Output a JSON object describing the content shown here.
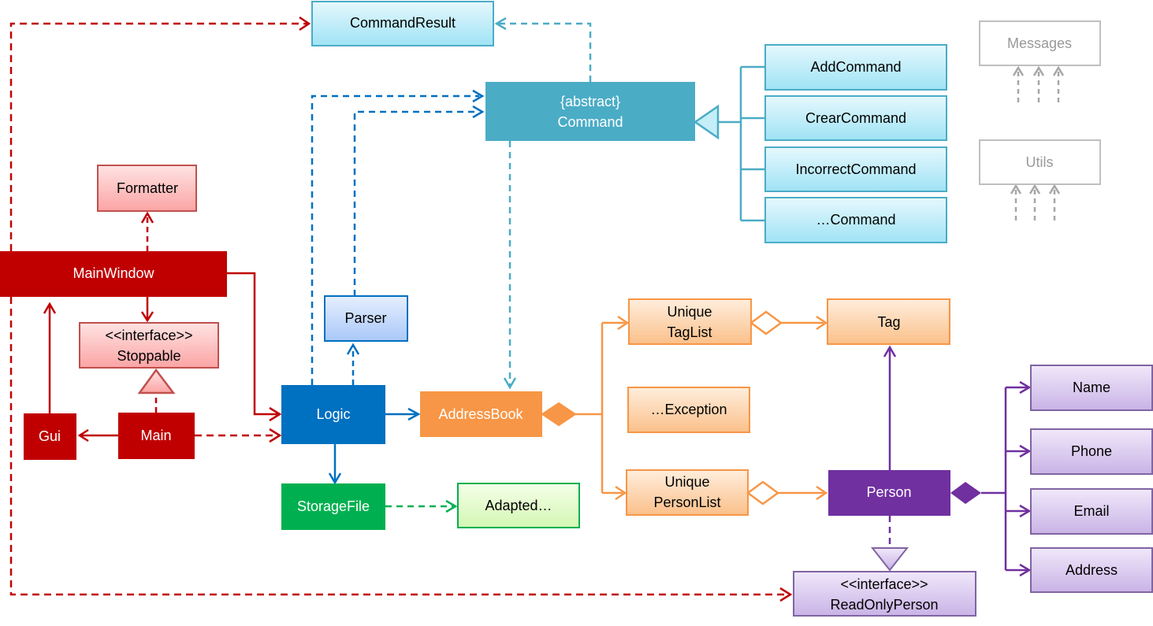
{
  "colors": {
    "ui": "#c00000",
    "logic": "#0070c0",
    "command": "#4bacc6",
    "model": "#f79646",
    "person": "#7030a0",
    "storage": "#00b050",
    "common": "#a6a6a6"
  },
  "boxes": {
    "command_result": "CommandResult",
    "command_stereotype": "{abstract}",
    "command": "Command",
    "add_command": "AddCommand",
    "crear_command": "CrearCommand",
    "incorrect_command": "IncorrectCommand",
    "other_command": "…Command",
    "messages": "Messages",
    "utils": "Utils",
    "formatter": "Formatter",
    "main_window": "MainWindow",
    "stoppable_stereotype": "<<interface>>",
    "stoppable": "Stoppable",
    "gui": "Gui",
    "main": "Main",
    "parser": "Parser",
    "logic": "Logic",
    "storage_file": "StorageFile",
    "adapted": "Adapted…",
    "address_book": "AddressBook",
    "unique_tag_list_1": "Unique",
    "unique_tag_list_2": "TagList",
    "tag": "Tag",
    "exception": "…Exception",
    "unique_person_list_1": "Unique",
    "unique_person_list_2": "PersonList",
    "person": "Person",
    "name": "Name",
    "phone": "Phone",
    "email": "Email",
    "address": "Address",
    "read_only_person_stereotype": "<<interface>>",
    "read_only_person": "ReadOnlyPerson"
  }
}
